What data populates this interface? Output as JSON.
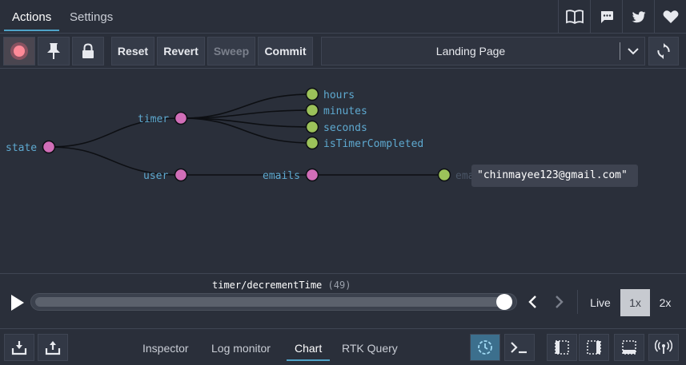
{
  "top_tabs": [
    {
      "label": "Actions",
      "active": true
    },
    {
      "label": "Settings",
      "active": false
    }
  ],
  "top_icons": [
    "book-icon",
    "chat-icon",
    "twitter-icon",
    "heart-icon"
  ],
  "toolbar": {
    "reset": "Reset",
    "revert": "Revert",
    "sweep": "Sweep",
    "commit": "Commit",
    "monitor_select": "Landing Page"
  },
  "tree": {
    "root": "state",
    "timer": "timer",
    "timer_children": [
      "hours",
      "minutes",
      "seconds",
      "isTimerCompleted"
    ],
    "user": "user",
    "emails": "emails",
    "email_leaf": "email",
    "tooltip": "\"chinmayee123@gmail.com\""
  },
  "slider": {
    "action_name": "timer/decrementTime",
    "action_count": "(49)",
    "progress": 1.0,
    "live": "Live",
    "speed_1x": "1x",
    "speed_2x": "2x"
  },
  "bottom_tabs": [
    {
      "label": "Inspector",
      "active": false
    },
    {
      "label": "Log monitor",
      "active": false
    },
    {
      "label": "Chart",
      "active": true
    },
    {
      "label": "RTK Query",
      "active": false
    }
  ],
  "colors": {
    "background": "#2a2f3a",
    "accent": "#4fa3c8",
    "node_parent": "#d16eb8",
    "node_leaf": "#9cc25a",
    "label": "#5ea9d0",
    "record": "#ff6b7d"
  }
}
